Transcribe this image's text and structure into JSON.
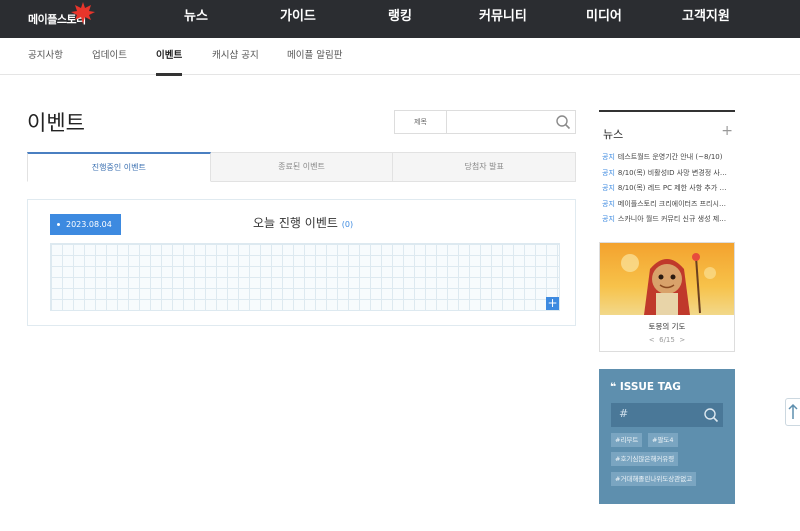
{
  "header": {
    "logo_text": "메이플스토리",
    "menu": [
      {
        "label": "뉴스"
      },
      {
        "label": "가이드"
      },
      {
        "label": "랭킹"
      },
      {
        "label": "커뮤니티"
      },
      {
        "label": "미디어"
      },
      {
        "label": "고객지원"
      }
    ]
  },
  "subnav": {
    "items": [
      {
        "label": "공지사항"
      },
      {
        "label": "업데이트"
      },
      {
        "label": "이벤트"
      },
      {
        "label": "캐시샵 공지"
      },
      {
        "label": "메이플 알림판"
      }
    ]
  },
  "main": {
    "title": "이벤트",
    "search": {
      "label": "제목",
      "placeholder": ""
    },
    "tabs": [
      {
        "label": "진행중인 이벤트"
      },
      {
        "label": "종료된 이벤트"
      },
      {
        "label": "당첨자 발표"
      }
    ],
    "event_box": {
      "date": "2023.08.04",
      "today_label": "오늘 진행 이벤트",
      "today_count": "(0)",
      "add_symbol": "+"
    }
  },
  "sidebar": {
    "news": {
      "title": "뉴스",
      "more_symbol": "+",
      "items": [
        {
          "tag": "공지",
          "text": "테스트월드 운영기간 안내 (~8/10)"
        },
        {
          "tag": "공지",
          "text": "8/10(목) 비활성ID 사망 변경정 사…"
        },
        {
          "tag": "공지",
          "text": "8/10(목) 레드 PC 제한 사항 추가 …"
        },
        {
          "tag": "공지",
          "text": "메이플스토리 크리에이터즈 프리시…"
        },
        {
          "tag": "공지",
          "text": "스카니아 월드 커뮤티 신규 생성 제…"
        }
      ]
    },
    "banner": {
      "caption": "토몽의 기도",
      "prev": "<",
      "page": "6/15",
      "next": ">"
    },
    "issue_tag": {
      "title": "ISSUE TAG",
      "hash": "#",
      "tags": [
        {
          "label": "#리부트"
        },
        {
          "label": "#팔도4"
        },
        {
          "label": "#호기심많은해커유령"
        },
        {
          "label": "#거대해졸린나위도상관없고"
        }
      ]
    }
  },
  "colors": {
    "topnav_bg": "#2b2d31",
    "accent_blue": "#3d8ae0",
    "issue_bg": "#5e8fae"
  }
}
